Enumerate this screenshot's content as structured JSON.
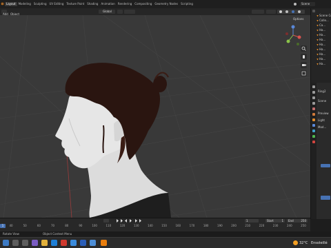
{
  "workspace_tabs": [
    "Layout",
    "Modeling",
    "Sculpting",
    "UV Editing",
    "Texture Paint",
    "Shading",
    "Animation",
    "Rendering",
    "Compositing",
    "Geometry Nodes",
    "Scripting"
  ],
  "active_tab": "Layout",
  "scene_name": "Scene",
  "viewport_header": {
    "menu_add": "Add",
    "menu_object": "Object",
    "transform_orientation": "Global",
    "options_label": "Options"
  },
  "outliner": {
    "rows": [
      "Scene Co...",
      "Colle...",
      "Ca...",
      "Ha...",
      "Ha...",
      "Ha...",
      "Ha...",
      "Ha...",
      "Ha...",
      "Ha...",
      "Ha..."
    ]
  },
  "properties": {
    "rows": [
      "Ring2",
      "Scene",
      "Preview",
      "Light",
      "Mod..."
    ]
  },
  "timeline": {
    "ticks": [
      "40",
      "50",
      "60",
      "70",
      "80",
      "90",
      "100",
      "110",
      "120",
      "130",
      "140",
      "150",
      "160",
      "170",
      "180",
      "190",
      "200",
      "210",
      "220",
      "230",
      "240",
      "250"
    ],
    "current_frame": "1",
    "start_label": "Start",
    "start_value": "1",
    "end_label": "End",
    "end_value": "250"
  },
  "statusbar": {
    "left": "Rotate View",
    "middle": "Object Context Menu"
  },
  "taskbar": {
    "temperature": "32°C",
    "weather_text": "Ensoleillé"
  },
  "colors": {
    "accent": "#4772b3",
    "grid_red": "#9b3b3b",
    "outliner_orange": "#e08b2b",
    "weather_sun": "#f4a024"
  }
}
